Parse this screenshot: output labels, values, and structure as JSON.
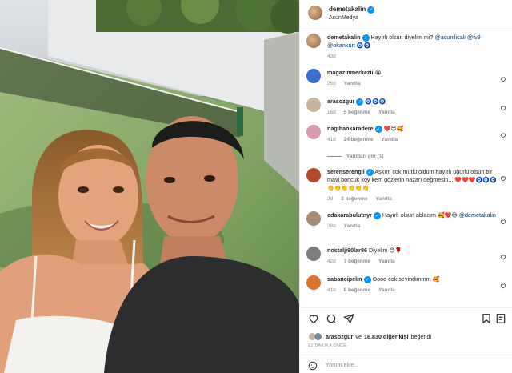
{
  "post": {
    "author": "demetakalin",
    "location": "AcunMedya",
    "caption_user": "demetakalin",
    "caption_text": "Hayırlı olsun diyelim mi?",
    "caption_mentions": "@acunilicali @tv8 @okankurt",
    "caption_emoji": "🧿🧿",
    "caption_time": "43d"
  },
  "comments": [
    {
      "user": "magazinmerkezii",
      "verified": false,
      "text": "",
      "emoji": "😭",
      "time": "26d",
      "likes": "",
      "reply": "Yanıtla",
      "avatar_color": "#3b6fd1"
    },
    {
      "user": "arasozgur",
      "verified": true,
      "text": "",
      "emoji": "🧿🧿🧿",
      "time": "16d",
      "likes": "5 beğenme",
      "reply": "Yanıtla",
      "avatar_color": "#c9b59b"
    },
    {
      "user": "nagihankaradere",
      "verified": true,
      "text": "",
      "emoji": "❤️😍🥰",
      "time": "41d",
      "likes": "24 beğenme",
      "reply": "Yanıtla",
      "avatar_color": "#d59ab0"
    },
    {
      "user": "serenserengil",
      "verified": true,
      "text": "Aşkım çok mutlu oldum hayırlı uğurlu olsun bir mavi boncuk koy kem gözlerin nazarı değmesin...",
      "emoji": "❤️❤️❤️🧿🧿🧿👏👏👏👏👏👏",
      "time": "2d",
      "likes": "3 beğenme",
      "reply": "Yanıtla",
      "avatar_color": "#b24a2e"
    },
    {
      "user": "edakarabulutnyr",
      "verified": true,
      "text": "Hayırlı olsun ablacım",
      "emoji": "🥰❤️😍",
      "mention": "@demetakalin",
      "time": "28d",
      "likes": "",
      "reply": "Yanıtla",
      "avatar_color": "#a58a76"
    },
    {
      "user": "nostalji90lar86",
      "verified": false,
      "text": "Diyelim",
      "emoji": "😊🌹",
      "time": "42d",
      "likes": "7 beğenme",
      "reply": "Yanıtla",
      "avatar_color": "#7d7d7d"
    },
    {
      "user": "sabancipelin",
      "verified": true,
      "text": "Oooo cok sevindimmm",
      "emoji": "🥰",
      "time": "41d",
      "likes": "8 beğenme",
      "reply": "Yanıtla",
      "avatar_color": "#d8742c"
    }
  ],
  "view_replies": "Yanıtları gör (1)",
  "likes": {
    "first_user": "arasozgur",
    "connector": "ve",
    "count_text": "16.830 diğer kişi",
    "suffix": "beğendi"
  },
  "timestamp": "12 DAKİKA ÖNCE",
  "compose_placeholder": "Yorum ekle...",
  "icons": [
    "heart-icon",
    "comment-icon",
    "share-icon",
    "bookmark-icon",
    "emoji-icon"
  ],
  "colors": {
    "verified": "#0095f6",
    "muted": "#8e8e8e",
    "link": "#00376b",
    "like_red": "#ed4956"
  }
}
